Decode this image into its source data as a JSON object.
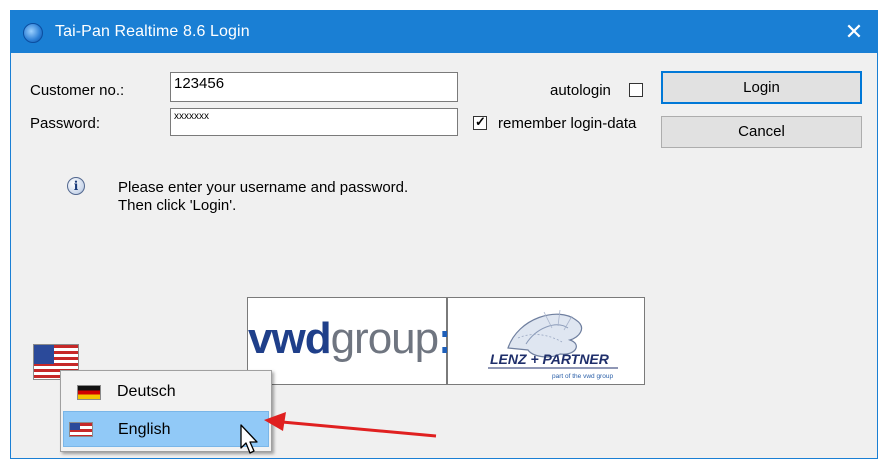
{
  "window": {
    "title": "Tai-Pan Realtime 8.6 Login",
    "close_symbol": "✕"
  },
  "form": {
    "customer_label": "Customer no.:",
    "customer_value": "123456",
    "password_label": "Password:",
    "password_value": "xxxxxxx",
    "autologin_label": "autologin",
    "autologin_checked": false,
    "remember_label": "remember login-data",
    "remember_checked": true
  },
  "buttons": {
    "login": "Login",
    "cancel": "Cancel"
  },
  "info": {
    "line1": "Please enter your username and password.",
    "line2": "Then click 'Login'."
  },
  "logos": {
    "vwd_bold": "vwd",
    "vwd_light": "group",
    "vwd_colon": ":",
    "lenz_text": "LENZ + PARTNER",
    "lenz_sub": "part of the vwd group"
  },
  "language_menu": {
    "items": [
      {
        "label": "Deutsch",
        "flag": "german-flag-icon"
      },
      {
        "label": "English",
        "flag": "us-flag-icon",
        "highlighted": true
      }
    ]
  },
  "colors": {
    "titlebar": "#1a7fd4",
    "highlight": "#91c9f7",
    "arrow": "#e02020"
  }
}
